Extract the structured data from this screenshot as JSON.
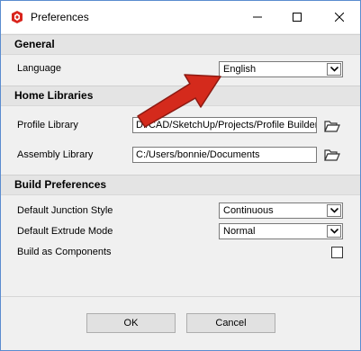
{
  "window": {
    "title": "Preferences"
  },
  "sections": {
    "general": "General",
    "home_libraries": "Home Libraries",
    "build_preferences": "Build Preferences"
  },
  "general": {
    "language_label": "Language",
    "language_value": "English"
  },
  "home_libraries": {
    "profile_label": "Profile Library",
    "profile_value": "D:/CAD/SketchUp/Projects/Profile Builder/",
    "assembly_label": "Assembly Library",
    "assembly_value": "C:/Users/bonnie/Documents"
  },
  "build": {
    "junction_label": "Default Junction Style",
    "junction_value": "Continuous",
    "extrude_label": "Default Extrude Mode",
    "extrude_value": "Normal",
    "components_label": "Build as Components",
    "components_checked": false
  },
  "footer": {
    "ok_label": "OK",
    "cancel_label": "Cancel"
  },
  "colors": {
    "annotation_arrow": "#d42a1c",
    "app_icon": "#d9251d"
  }
}
